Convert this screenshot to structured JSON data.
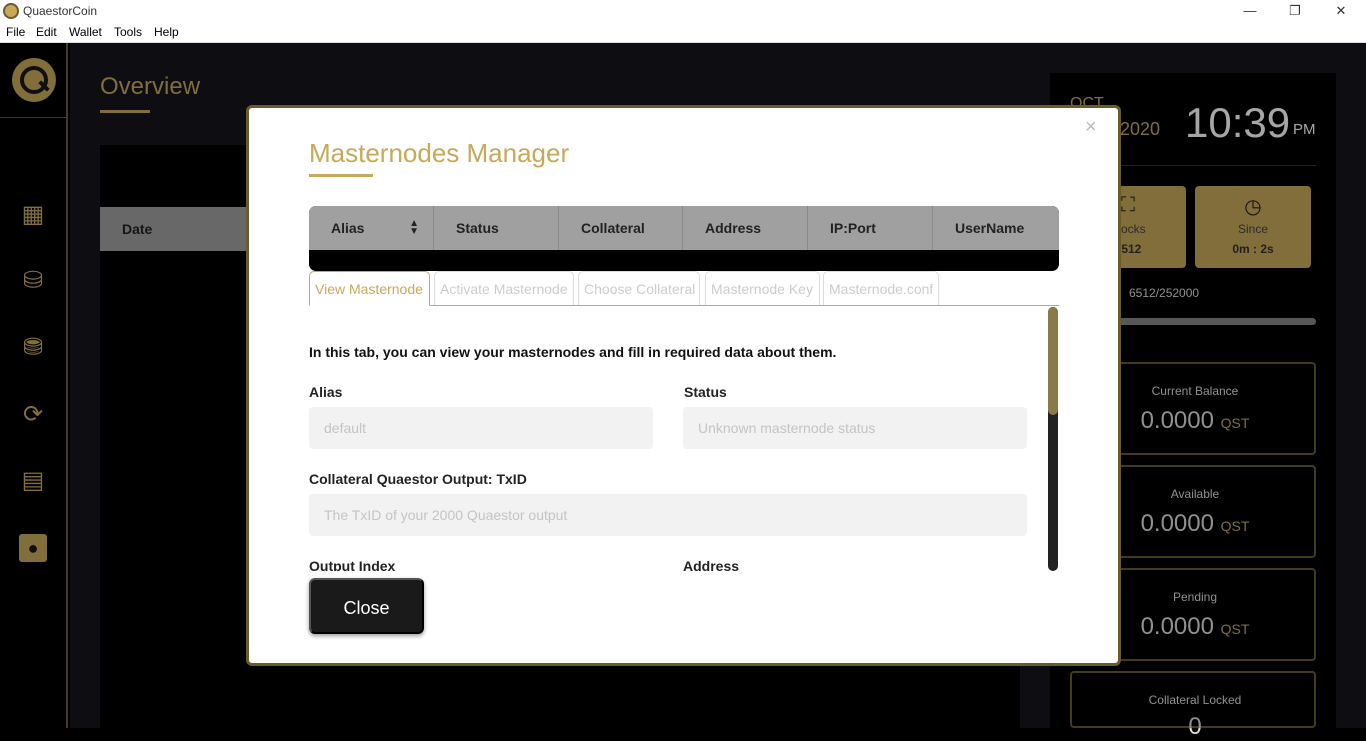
{
  "window": {
    "title": "QuaestorCoin",
    "minimize": "—",
    "restore": "❐",
    "close": "✕"
  },
  "menu": [
    "File",
    "Edit",
    "Wallet",
    "Tools",
    "Help"
  ],
  "sidebar": {
    "icons": [
      "dashboard-icon",
      "send-icon",
      "receive-icon",
      "transactions-icon",
      "masternodes-icon",
      "contacts-icon"
    ]
  },
  "overview": {
    "title": "Overview",
    "table_header_date": "Date"
  },
  "clock": {
    "month": "OCT",
    "year": "2020",
    "time": "10:39",
    "ampm": "PM"
  },
  "stats": {
    "blocks_label": "Blocks",
    "blocks_value": "6512",
    "since_label": "Since",
    "since_value": "0m : 2s"
  },
  "sync": {
    "text": "6512/252000",
    "fraction": 0.0258
  },
  "balances": [
    {
      "label": "Current Balance",
      "amount": "0.0000",
      "unit": "QST"
    },
    {
      "label": "Available",
      "amount": "0.0000",
      "unit": "QST"
    },
    {
      "label": "Pending",
      "amount": "0.0000",
      "unit": "QST"
    },
    {
      "label": "Collateral Locked",
      "amount": "0",
      "unit": ""
    }
  ],
  "modal": {
    "close_x": "×",
    "title": "Masternodes Manager",
    "columns": [
      "Alias",
      "Status",
      "Collateral",
      "Address",
      "IP:Port",
      "UserName"
    ],
    "tabs": [
      "View Masternode",
      "Activate Masternode",
      "Choose Collateral",
      "Masternode Key",
      "Masternode.conf"
    ],
    "intro": "In this tab, you can view your masternodes and fill in required data about them.",
    "alias_label": "Alias",
    "alias_placeholder": "default",
    "status_label": "Status",
    "status_placeholder": "Unknown masternode status",
    "txid_label": "Collateral Quaestor Output: TxID",
    "txid_placeholder": "The TxID of your 2000 Quaestor output",
    "output_index_label": "Output Index",
    "address_label": "Address",
    "close_button": "Close"
  }
}
